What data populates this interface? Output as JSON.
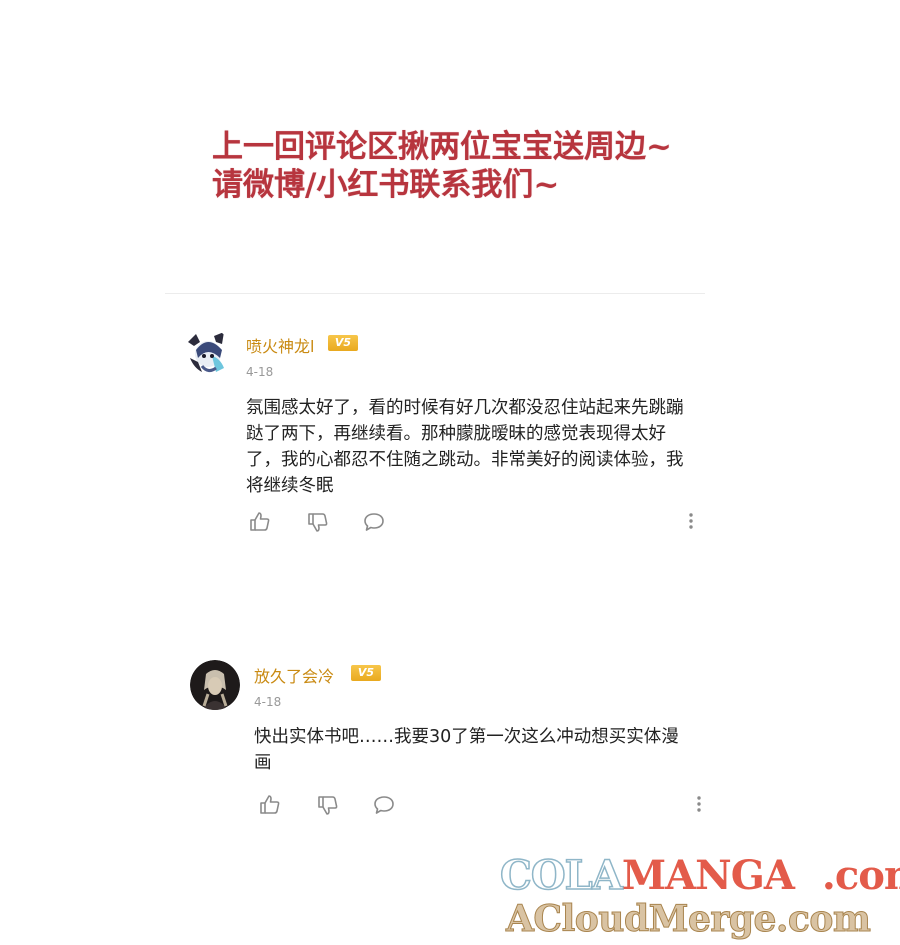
{
  "announcement": {
    "line1": "上一回评论区揪两位宝宝送周边~",
    "line2": "请微博/小红书联系我们~"
  },
  "comments": [
    {
      "username": "喷火神龙l",
      "vip_badge": "V5",
      "date": "4-18",
      "text": "氛围感太好了，看的时候有好几次都没忍住站起来先跳蹦跶了两下，再继续看。那种朦胧暧昧的感觉表现得太好了，我的心都忍不住随之跳动。非常美好的阅读体验，我将继续冬眠"
    },
    {
      "username": "放久了会冷",
      "vip_badge": "V5",
      "date": "4-18",
      "text": "快出实体书吧……我要30了第一次这么冲动想买实体漫画"
    }
  ],
  "actions": {
    "like_icon": "thumbs-up-icon",
    "dislike_icon": "thumbs-down-icon",
    "reply_icon": "comment-bubble-icon",
    "more_icon": "more-vertical-icon"
  },
  "watermark": {
    "line1_part1": "COLA",
    "line1_part2": "MANGA",
    "line1_part3": ".com",
    "line2": "ACloudMerge.com"
  },
  "colors": {
    "announcement": "#b7353e",
    "username": "#c98a12",
    "vip_badge": "#f0b533",
    "date": "#999999",
    "body_text": "#222222",
    "icon": "#8a8a8a"
  }
}
